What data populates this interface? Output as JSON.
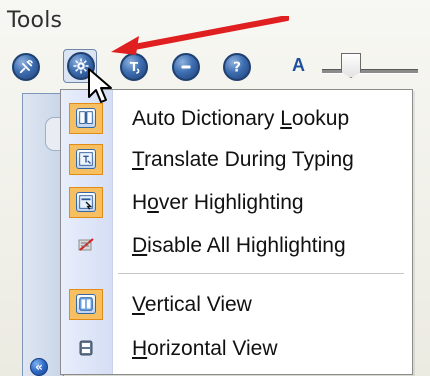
{
  "toolbar": {
    "title": "Tools",
    "items": [
      {
        "name": "tools"
      },
      {
        "name": "settings"
      },
      {
        "name": "translate"
      },
      {
        "name": "remove"
      },
      {
        "name": "help"
      }
    ],
    "font_size_label": "A"
  },
  "menu": {
    "items": [
      {
        "label": "Auto Dictionary Lookup",
        "underline_index": 16,
        "checked": true,
        "icon": "book-icon"
      },
      {
        "label": "Translate During Typing",
        "underline_index": 0,
        "checked": true,
        "icon": "translate-typing-icon"
      },
      {
        "label": "Hover Highlighting",
        "underline_index": 1,
        "checked": true,
        "icon": "hover-highlight-icon"
      },
      {
        "label": "Disable All Highlighting",
        "underline_index": 0,
        "checked": false,
        "icon": "disable-highlight-icon"
      },
      {
        "label": "Vertical View",
        "underline_index": 0,
        "checked": true,
        "icon": "vertical-view-icon"
      },
      {
        "label": "Horizontal View",
        "underline_index": 0,
        "checked": false,
        "icon": "horizontal-view-icon"
      }
    ]
  },
  "side": {
    "collapse_label": "«"
  },
  "colors": {
    "accent": "#f5bf62",
    "arrow": "#e02020",
    "menu_gutter": "#d5def5",
    "toolbar_button": "#3f6fb1"
  }
}
